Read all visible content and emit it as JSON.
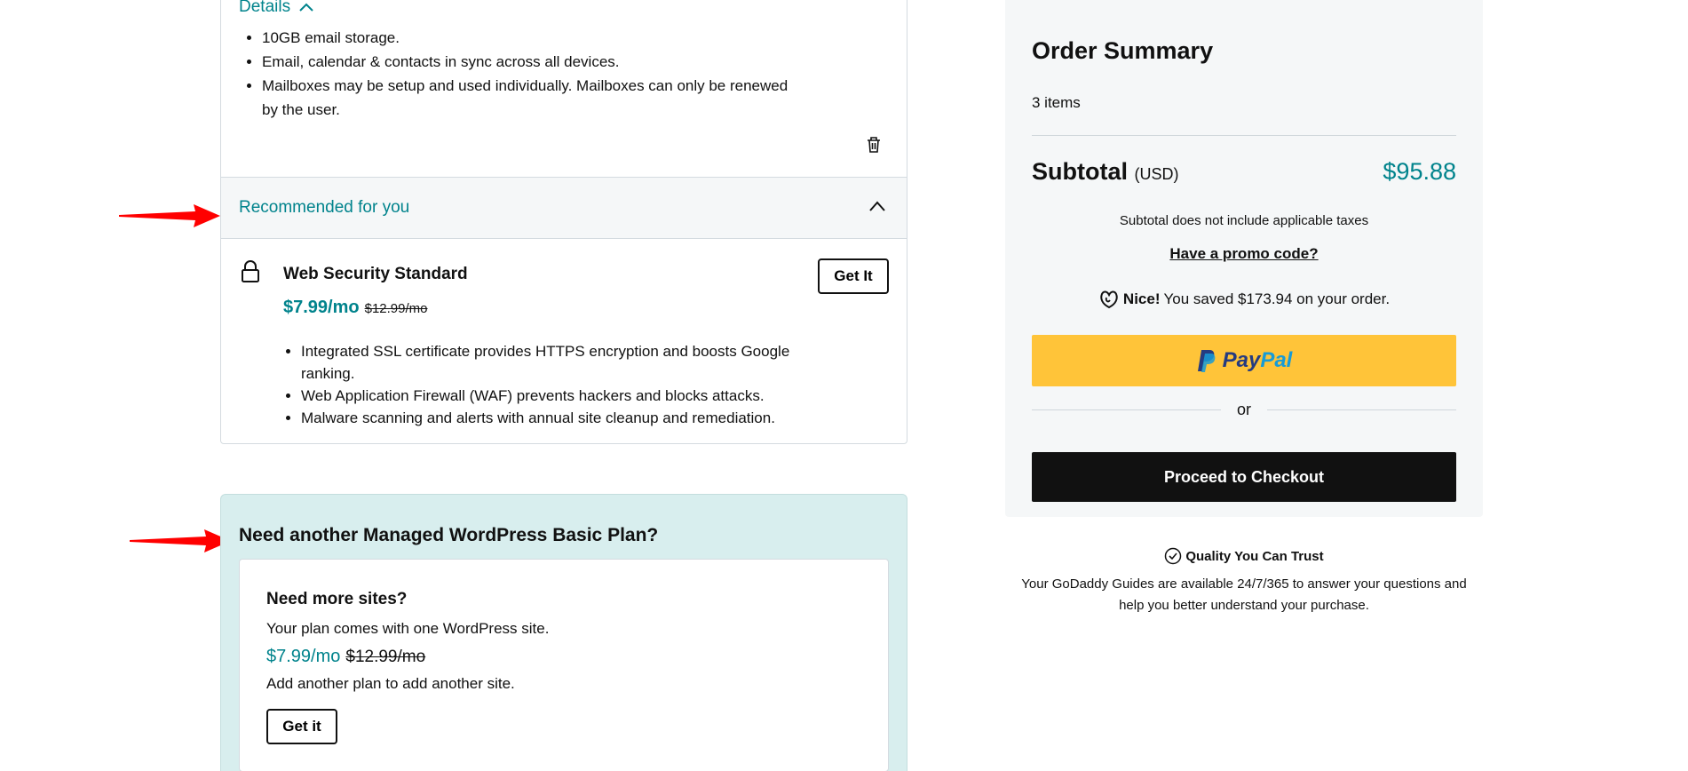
{
  "cart_item": {
    "details_label": "Details",
    "features": [
      "10GB email storage.",
      "Email, calendar & contacts in sync across all devices.",
      "Mailboxes may be setup and used individually. Mailboxes can only be renewed by the user."
    ]
  },
  "recommended": {
    "title": "Recommended for you",
    "product": {
      "name": "Web Security Standard",
      "price": "$7.99/mo",
      "original_price": "$12.99/mo",
      "button_label": "Get It",
      "features": [
        "Integrated SSL certificate provides HTTPS encryption and boosts Google ranking.",
        "Web Application Firewall (WAF) prevents hackers and blocks attacks.",
        "Malware scanning and alerts with annual site cleanup and remediation."
      ]
    }
  },
  "upsell": {
    "title": "Need another Managed WordPress Basic Plan?",
    "card_title": "Need more sites?",
    "description": "Your plan comes with one WordPress site.",
    "price": "$7.99/mo",
    "original_price": "$12.99/mo",
    "add_text": "Add another plan to add another site.",
    "button_label": "Get it",
    "background_color": "#d8eeee"
  },
  "order_summary": {
    "title": "Order Summary",
    "items_count": "3 items",
    "subtotal_label": "Subtotal",
    "currency": "(USD)",
    "subtotal_amount": "$95.88",
    "tax_note": "Subtotal does not include applicable taxes",
    "promo_link": "Have a promo code?",
    "savings_bold": "Nice!",
    "savings_text": "You saved $173.94 on your order.",
    "paypal_label_1": "Pay",
    "paypal_label_2": "Pal",
    "or_text": "or",
    "checkout_label": "Proceed to Checkout"
  },
  "trust": {
    "title": "Quality You Can Trust",
    "text": "Your GoDaddy Guides are available 24/7/365 to answer your questions and help you better understand your purchase."
  },
  "colors": {
    "accent": "#00838c",
    "paypal_yellow": "#ffc439",
    "checkout_black": "#111111",
    "annotation_red": "#ff0000"
  }
}
